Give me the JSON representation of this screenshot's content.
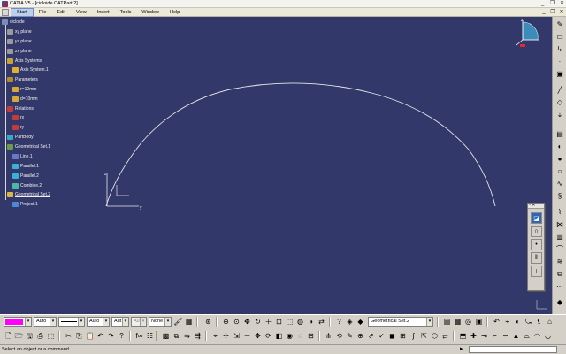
{
  "window": {
    "title": "CATIA V5 - [cicloide.CATPart.2]",
    "min": "_",
    "restore": "❐",
    "close": "✕"
  },
  "menu": {
    "items": [
      "Start",
      "File",
      "Edit",
      "View",
      "Insert",
      "Tools",
      "Window",
      "Help"
    ],
    "doc_min": "_",
    "doc_restore": "❐",
    "doc_close": "✕"
  },
  "tree": {
    "root": "cicloide",
    "xy_plane": "xy plane",
    "yz_plane": "yz plane",
    "zx_plane": "zx plane",
    "axis_systems": "Axis Systems",
    "axis_system_1": "Axis System.1",
    "parameters": "Parameters",
    "param_r": "r=10mm",
    "param_d": "d=10mm",
    "relations": "Relations",
    "rel_rx": "rx",
    "rel_ry": "ry",
    "partbody": "PartBody",
    "geo_set_1": "Geometrical Set.1",
    "line_1": "Line.1",
    "parallel_1": "Parallel.1",
    "parallel_2": "Parallel.2",
    "combine_2": "Combine.2",
    "geo_set_2": "Geometrical Set.2",
    "project_1": "Project.1"
  },
  "axis": {
    "z": "z",
    "y": "y"
  },
  "compass_label": "z",
  "properties": {
    "color": "#ff00ff",
    "color_mode": "Auto",
    "linetype_mode": "Auto",
    "thickness": "Aut",
    "point": "Aut",
    "layer": "None"
  },
  "geo_set_dropdown": "Geometrical Set.2",
  "status": {
    "message": "Select an object or a command"
  },
  "colors": {
    "background": "#33386a",
    "curve": "#e6e6e6",
    "tree_text": "#f2f2f2",
    "chrome": "#d4d0c8"
  }
}
